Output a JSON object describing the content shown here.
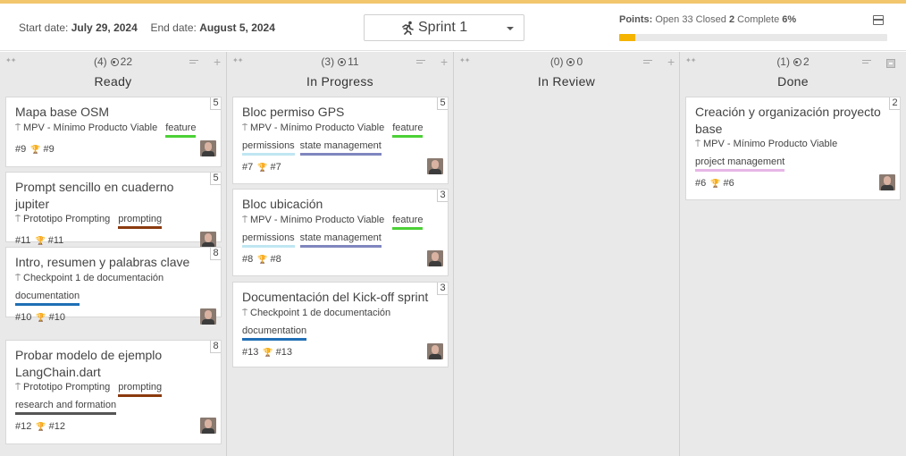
{
  "header": {
    "start_label": "Start date:",
    "start_value": "July 29, 2024",
    "end_label": "End date:",
    "end_value": "August 5, 2024",
    "sprint_selected": "Sprint 1",
    "points_label": "Points:",
    "open_label": "Open",
    "open_value": "33",
    "closed_label": "Closed",
    "closed_value": "2",
    "complete_label": "Complete",
    "complete_value": "6%",
    "progress_fraction": 0.06,
    "progress_color": "#f4b400"
  },
  "columns": [
    {
      "count": "(4)",
      "points": "22",
      "title": "Ready",
      "cards": [
        {
          "title": "Mapa base OSM",
          "points": "5",
          "milestone": "MPV - Mínimo Producto Viable",
          "tags": [
            "feature"
          ],
          "ref": "#9",
          "ref2": "#9"
        },
        {
          "title": "Prompt sencillo en cuaderno jupiter",
          "points": "5",
          "milestone": "Prototipo Prompting",
          "tags": [
            "prompting"
          ],
          "ref": "#11",
          "ref2": "#11"
        },
        {
          "title": "Intro, resumen y palabras clave",
          "points": "8",
          "milestone": "Checkpoint 1 de documentación",
          "tags": [
            "documentation"
          ],
          "ref": "#10",
          "ref2": "#10"
        },
        {
          "title": "Probar modelo de ejemplo LangChain.dart",
          "points": "8",
          "milestone": "Prototipo Prompting",
          "tags": [
            "prompting",
            "research and formation"
          ],
          "ref": "#12",
          "ref2": "#12"
        }
      ]
    },
    {
      "count": "(3)",
      "points": "11",
      "title": "In Progress",
      "cards": [
        {
          "title": "Bloc permiso GPS",
          "points": "5",
          "milestone": "MPV - Mínimo Producto Viable",
          "tags": [
            "feature",
            "permissions",
            "state management"
          ],
          "ref": "#7",
          "ref2": "#7"
        },
        {
          "title": "Bloc ubicación",
          "points": "3",
          "milestone": "MPV - Mínimo Producto Viable",
          "tags": [
            "feature",
            "permissions",
            "state management"
          ],
          "ref": "#8",
          "ref2": "#8"
        },
        {
          "title": "Documentación del Kick-off sprint",
          "points": "3",
          "milestone": "Checkpoint 1 de documentación",
          "tags": [
            "documentation"
          ],
          "ref": "#13",
          "ref2": "#13"
        }
      ]
    },
    {
      "count": "(0)",
      "points": "0",
      "title": "In Review",
      "cards": []
    },
    {
      "count": "(1)",
      "points": "2",
      "title": "Done",
      "cards": [
        {
          "title": "Creación y organización proyecto base",
          "points": "2",
          "milestone": "MPV - Mínimo Producto Viable",
          "tags": [
            "project management"
          ],
          "ref": "#6",
          "ref2": "#6"
        }
      ]
    }
  ],
  "tag_colors": {
    "feature": "#4cd137",
    "prompting": "#8b3a0e",
    "documentation": "#1f6fb5",
    "research and formation": "#555555",
    "permissions": "#bfe6f2",
    "state management": "#7f86bf",
    "project management": "#e7b6e7"
  }
}
